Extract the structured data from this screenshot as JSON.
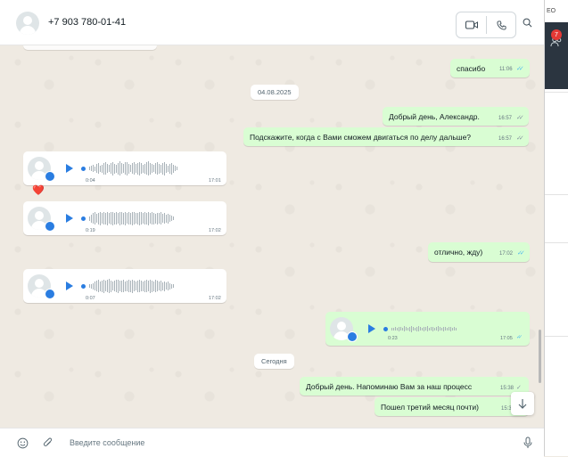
{
  "header": {
    "contact_name": "+7 903 780-01-41"
  },
  "messages": [
    {
      "type": "text",
      "dir": "out",
      "text": "спасибо",
      "time": "11:06",
      "status": "read"
    },
    {
      "type": "date",
      "text": "04.08.2025"
    },
    {
      "type": "text",
      "dir": "out",
      "text": "Добрый день, Александр.",
      "time": "16:57",
      "status": "sent"
    },
    {
      "type": "text",
      "dir": "out",
      "text": "Подскажите, когда с Вами сможем двигаться по делу дальше?",
      "time": "16:57",
      "status": "sent"
    },
    {
      "type": "voice",
      "dir": "in",
      "duration": "0:04",
      "time": "17:01",
      "reaction": "❤️"
    },
    {
      "type": "voice",
      "dir": "in",
      "duration": "0:19",
      "time": "17:02"
    },
    {
      "type": "text",
      "dir": "out",
      "text": "отлично, жду)",
      "time": "17:02",
      "status": "read"
    },
    {
      "type": "voice",
      "dir": "in",
      "duration": "0:07",
      "time": "17:02"
    },
    {
      "type": "voice",
      "dir": "out",
      "duration": "0:23",
      "time": "17:05",
      "status": "read"
    },
    {
      "type": "date",
      "text": "Сегодня"
    },
    {
      "type": "text",
      "dir": "out",
      "text": "Добрый день. Напоминаю Вам за наш процесс",
      "time": "15:38",
      "status": "sent"
    },
    {
      "type": "text",
      "dir": "out",
      "text": "Пошел третий месяц почти)",
      "time": "15:3",
      "status": "sent"
    }
  ],
  "composer": {
    "placeholder": "Введите сообщение"
  },
  "side": {
    "logo_text": "ЕО",
    "badge_count": "7"
  },
  "colors": {
    "outgoing_bubble": "#d9fdd3",
    "incoming_bubble": "#ffffff",
    "accent": "#2a7de1",
    "read_check": "#53bdeb"
  }
}
